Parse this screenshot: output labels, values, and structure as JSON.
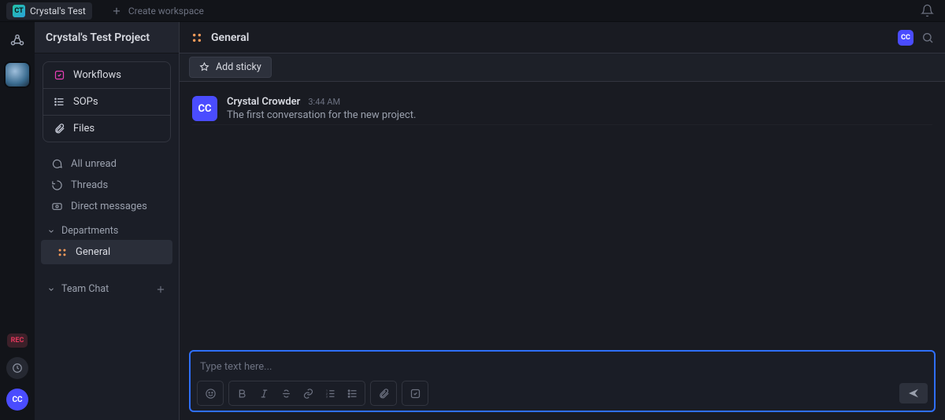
{
  "topstrip": {
    "workspace_avatar": "CT",
    "workspace_name": "Crystal's Test",
    "create_workspace": "Create workspace"
  },
  "rail": {
    "rec_label": "REC",
    "me_initials": "CC"
  },
  "sidebar": {
    "project_title": "Crystal's Test Project",
    "rows": {
      "workflows": "Workflows",
      "sops": "SOPs",
      "files": "Files"
    },
    "list": {
      "all_unread": "All unread",
      "threads": "Threads",
      "dms": "Direct messages"
    },
    "groups": {
      "departments": {
        "label": "Departments",
        "general": "General"
      },
      "team_chat": {
        "label": "Team Chat"
      }
    }
  },
  "header": {
    "channel_name": "General",
    "member_initials": "CC"
  },
  "toolbar": {
    "add_sticky": "Add sticky"
  },
  "messages": [
    {
      "avatar": "CC",
      "author": "Crystal Crowder",
      "time": "3:44 AM",
      "body": "The first conversation for the new project."
    }
  ],
  "composer": {
    "placeholder": "Type text here..."
  }
}
